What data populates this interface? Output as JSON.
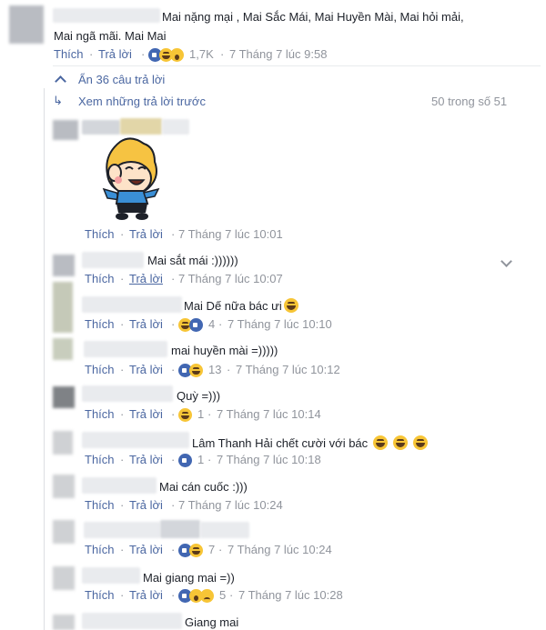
{
  "top_comment": {
    "text_line1": "Mai nặng mại , Mai Sắc Mái, Mai Huyền Mài, Mai hỏi mải,",
    "text_line2": "Mai ngã mãi. Mai Mai",
    "like": "Thích",
    "reply": "Trả lời",
    "reaction_count": "1,7K",
    "time": "7 Tháng 7 lúc 9:58"
  },
  "hide_replies": {
    "label": "Ẩn 36 câu trả lời",
    "icon": "chevron-up-icon"
  },
  "previous_replies": {
    "label": "Xem những trả lời trước",
    "icon": "reply-arrow-icon",
    "count": "50 trong số 51"
  },
  "replies": [
    {
      "text": "",
      "like": "Thích",
      "reply": "Trả lời",
      "reactions": "",
      "time": "7 Tháng 7 lúc 10:01",
      "sticker": "laughing-boy-sticker"
    },
    {
      "text": "Mai sắt mái :))))))",
      "like": "Thích",
      "reply": "Trả lời",
      "reactions": "",
      "time": "7 Tháng 7 lúc 10:07"
    },
    {
      "text": "Mai Dế nữa bác ưi",
      "like": "Thích",
      "reply": "Trả lời",
      "reactions": "4",
      "time": "7 Tháng 7 lúc 10:10"
    },
    {
      "text": "mai huyền mài =)))))",
      "like": "Thích",
      "reply": "Trả lời",
      "reactions": "13",
      "time": "7 Tháng 7 lúc 10:12"
    },
    {
      "text": "Quỳ =)))",
      "like": "Thích",
      "reply": "Trả lời",
      "reactions": "1",
      "time": "7 Tháng 7 lúc 10:14"
    },
    {
      "text": "Lâm Thanh Hải chết cười với bác",
      "like": "Thích",
      "reply": "Trả lời",
      "reactions": "1",
      "time": "7 Tháng 7 lúc 10:18"
    },
    {
      "text": "Mai cán cuốc :)))",
      "like": "Thích",
      "reply": "Trả lời",
      "reactions": "",
      "time": "7 Tháng 7 lúc 10:24"
    },
    {
      "text": "",
      "like": "Thích",
      "reply": "Trả lời",
      "reactions": "7",
      "time": "7 Tháng 7 lúc 10:24"
    },
    {
      "text": "Mai giang mai =))",
      "like": "Thích",
      "reply": "Trả lời",
      "reactions": "5",
      "time": "7 Tháng 7 lúc 10:28"
    },
    {
      "text": "Giang mai",
      "like": "",
      "reply": "",
      "reactions": "",
      "time": ""
    }
  ],
  "colors": {
    "link": "#4b67a1",
    "meta": "#90949c",
    "like_blue": "#4267b2",
    "emoji_yellow": "#f7c536"
  }
}
